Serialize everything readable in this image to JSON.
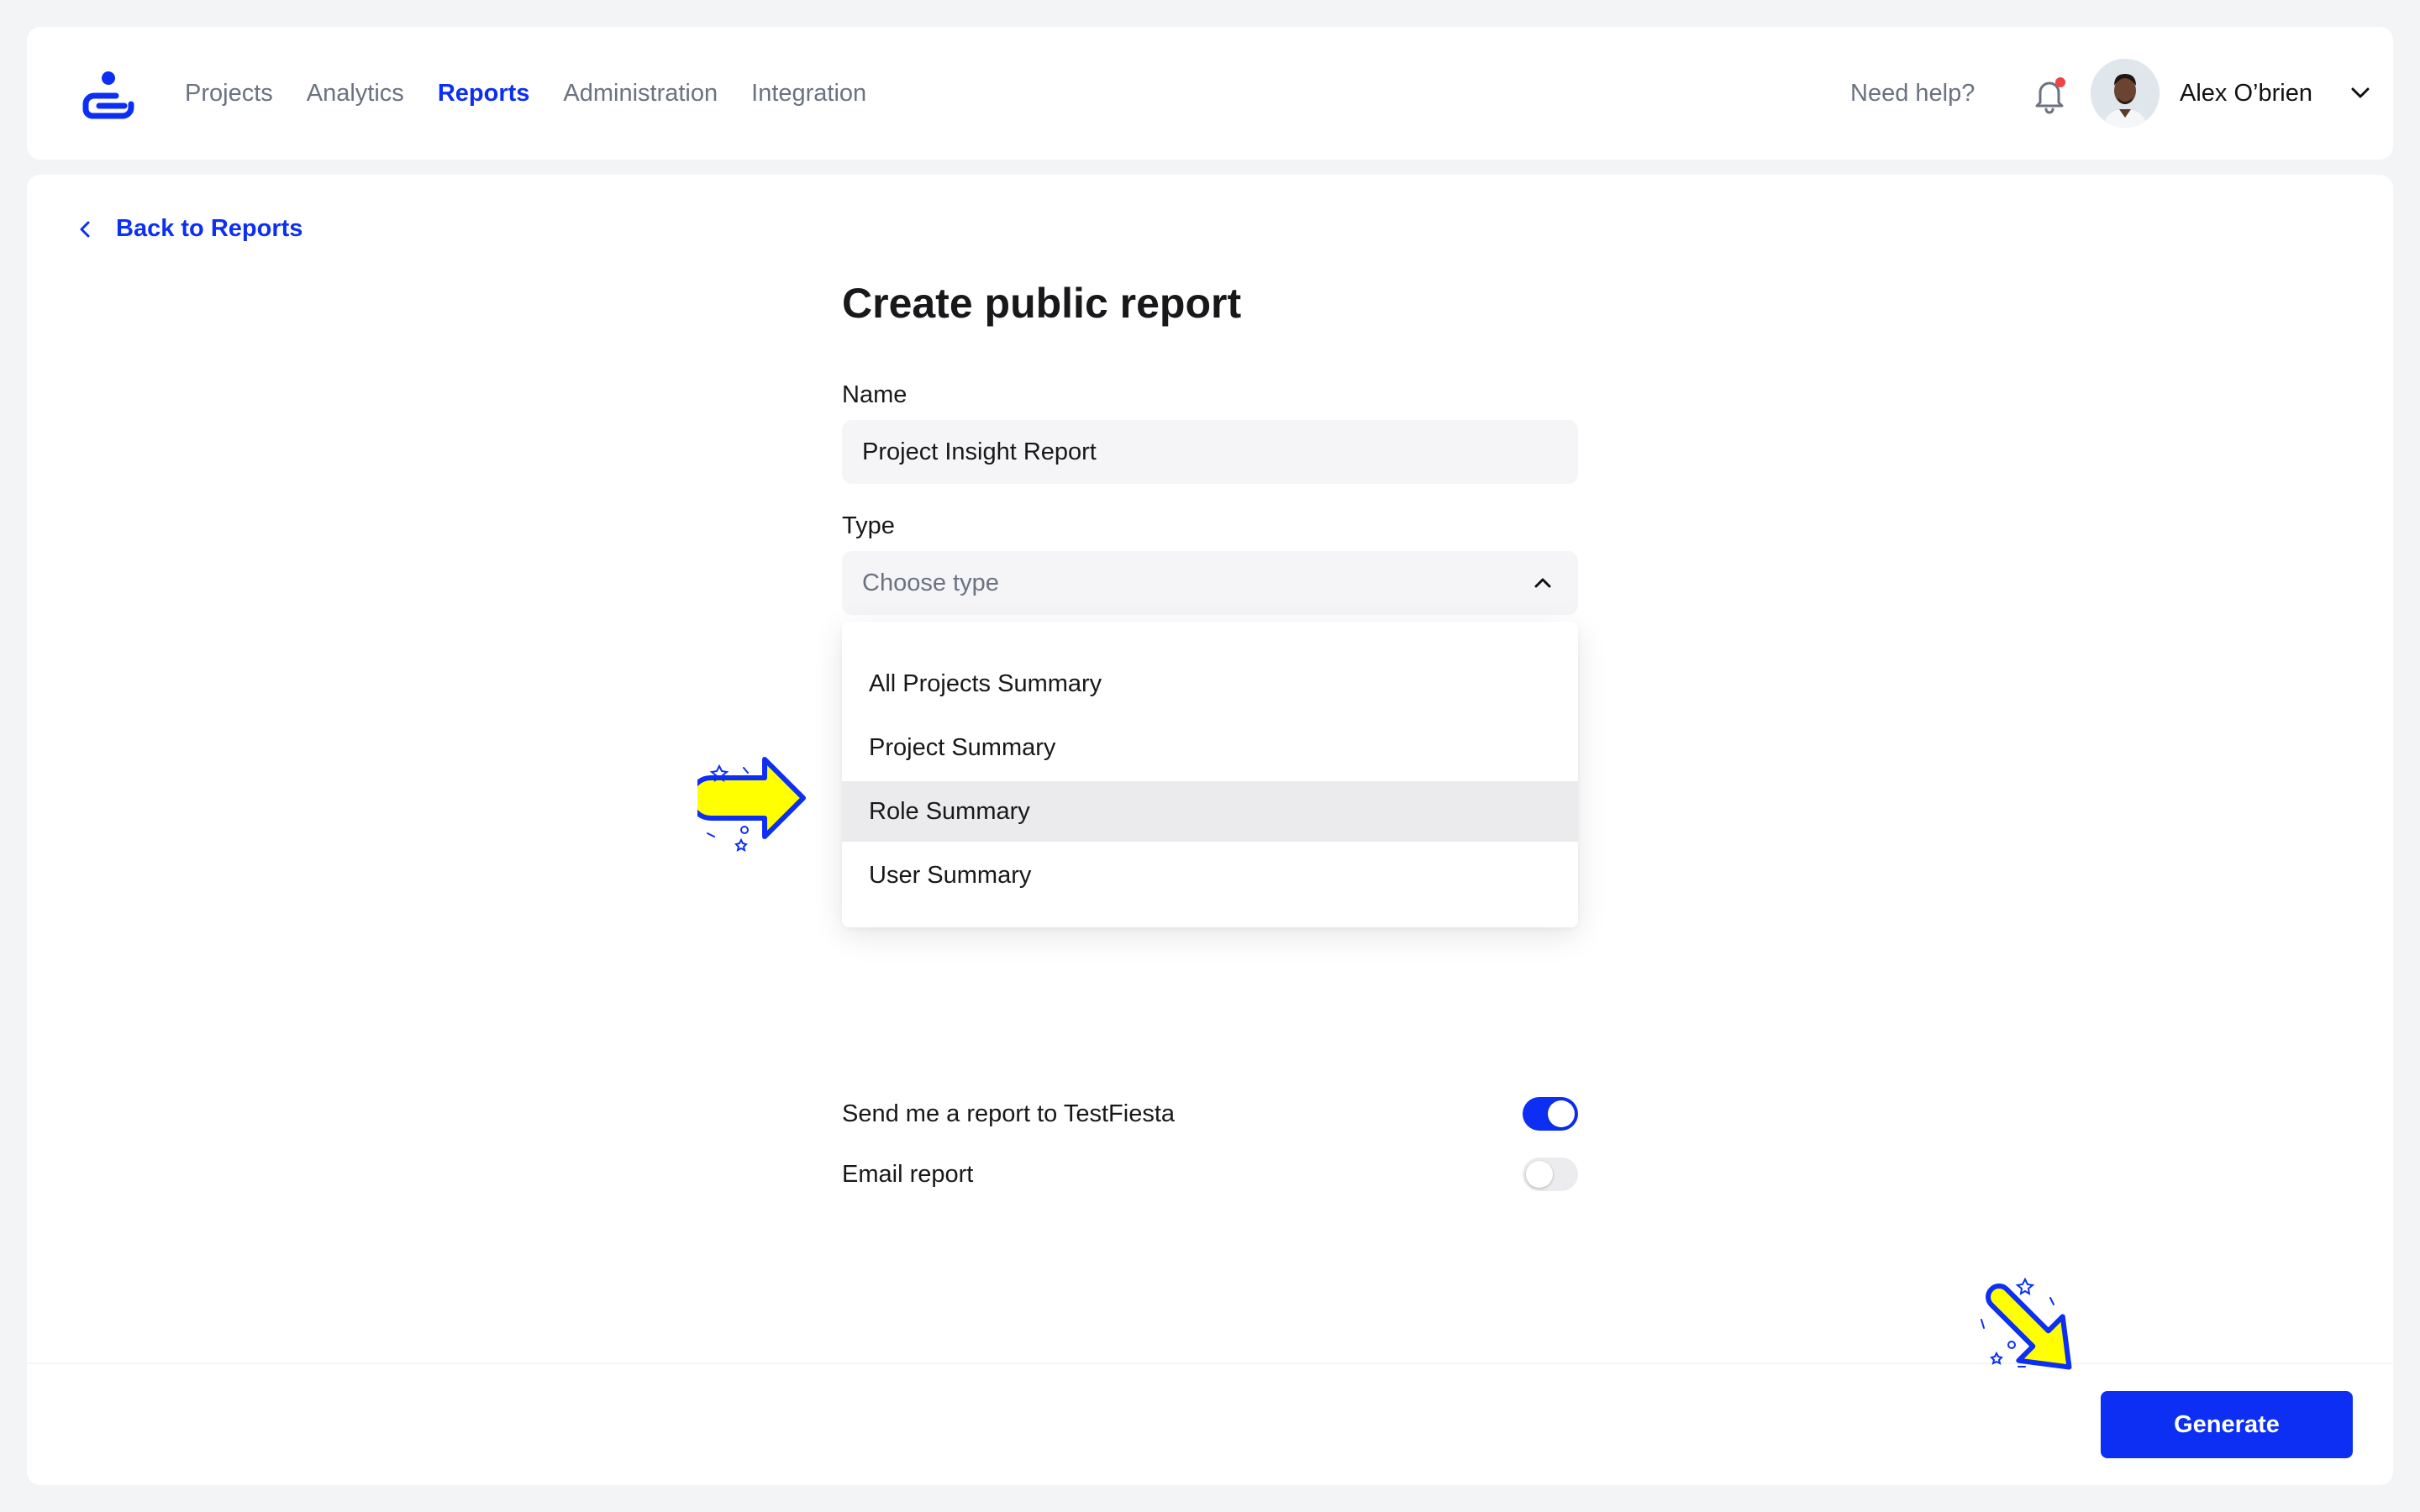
{
  "app": {
    "nav": [
      {
        "label": "Projects",
        "active": false
      },
      {
        "label": "Analytics",
        "active": false
      },
      {
        "label": "Reports",
        "active": true
      },
      {
        "label": "Administration",
        "active": false
      },
      {
        "label": "Integration",
        "active": false
      }
    ],
    "help_label": "Need help?",
    "user": {
      "name": "Alex O’brien"
    },
    "notification_dot_color": "#ef4444",
    "accent_color": "#0c2ff3"
  },
  "page": {
    "back_label": "Back to Reports",
    "title": "Create public report",
    "name_field": {
      "label": "Name",
      "value": "Project Insight Report"
    },
    "type_field": {
      "label": "Type",
      "placeholder": "Choose type",
      "expanded": true
    },
    "type_options": [
      {
        "label": "All Projects Summary",
        "highlighted": false
      },
      {
        "label": "Project Summary",
        "highlighted": false
      },
      {
        "label": "Role Summary",
        "highlighted": true
      },
      {
        "label": "User Summary",
        "highlighted": false
      }
    ],
    "toggles": [
      {
        "label": "Send me a report to TestFiesta",
        "on": true
      },
      {
        "label": "Email report",
        "on": false
      }
    ],
    "generate_label": "Generate"
  },
  "annotations": {
    "arrow_color": "#ffff00",
    "arrow_outline": "#0c2ff3",
    "icons": [
      "arrow-right-icon",
      "arrow-down-right-icon"
    ]
  }
}
